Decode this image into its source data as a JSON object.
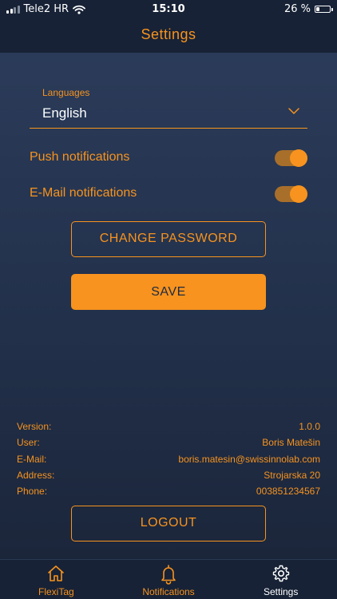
{
  "status_bar": {
    "carrier": "Tele2 HR",
    "time": "15:10",
    "battery_text": "26 %",
    "battery_level": 0.26,
    "signal_bars": 2
  },
  "nav": {
    "title": "Settings"
  },
  "language": {
    "label": "Languages",
    "value": "English"
  },
  "toggles": [
    {
      "label": "Push notifications",
      "on": true
    },
    {
      "label": "E-Mail notifications",
      "on": true
    }
  ],
  "buttons": {
    "change_password": "CHANGE PASSWORD",
    "save": "SAVE",
    "logout": "LOGOUT"
  },
  "info": {
    "version_key": "Version:",
    "version_val": "1.0.0",
    "user_key": "User:",
    "user_val": "Boris Matešin",
    "email_key": "E-Mail:",
    "email_val": "boris.matesin@swissinnolab.com",
    "address_key": "Address:",
    "address_val": "Strojarska 20",
    "phone_key": "Phone:",
    "phone_val": "003851234567"
  },
  "tabs": [
    {
      "label": "FlexiTag",
      "icon": "home-icon",
      "active": false
    },
    {
      "label": "Notifications",
      "icon": "bell-icon",
      "active": false
    },
    {
      "label": "Settings",
      "icon": "gear-icon",
      "active": true
    }
  ],
  "colors": {
    "accent": "#f7931e",
    "bar_background": "#172236",
    "active_tab_text": "#ffffff"
  }
}
